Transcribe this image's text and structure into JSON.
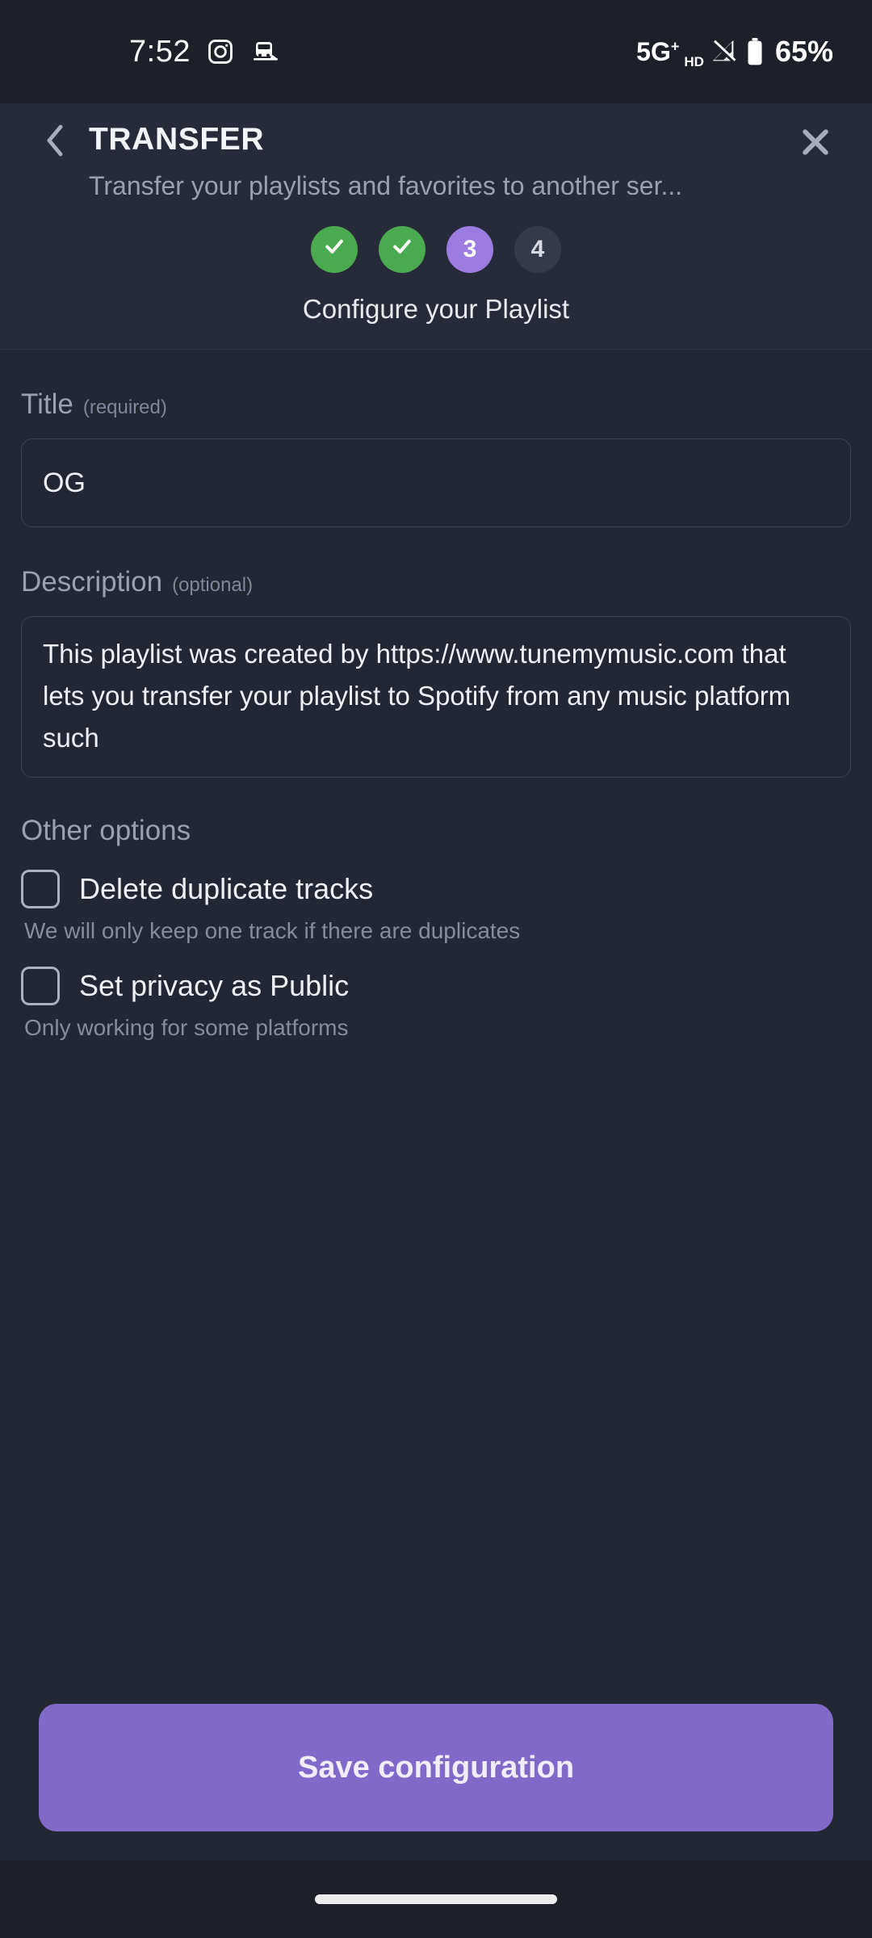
{
  "status_bar": {
    "time": "7:52",
    "icons": [
      "instagram-icon",
      "train-icon"
    ],
    "network": "5G",
    "network_plus": "+",
    "network_hd": "HD",
    "battery_percent": "65%"
  },
  "header": {
    "back_icon": "chevron-left-icon",
    "title": "TRANSFER",
    "subtitle": "Transfer your playlists and favorites to another ser...",
    "close_icon": "close-icon",
    "steps": [
      {
        "label": "✓",
        "state": "done"
      },
      {
        "label": "✓",
        "state": "done"
      },
      {
        "label": "3",
        "state": "current"
      },
      {
        "label": "4",
        "state": "pending"
      }
    ],
    "step_caption": "Configure your Playlist"
  },
  "form": {
    "title_field": {
      "label": "Title",
      "hint": "(required)",
      "value": "OG",
      "placeholder": "Title"
    },
    "description_field": {
      "label": "Description",
      "hint": "(optional)",
      "value": "This playlist was created by https://www.tunemymusic.com that lets you transfer your playlist to Spotify from any music platform such",
      "placeholder": "Description"
    }
  },
  "other_options": {
    "section_label": "Other options",
    "items": [
      {
        "title": "Delete duplicate tracks",
        "description": "We will only keep one track if there are duplicates",
        "checked": false
      },
      {
        "title": "Set privacy as Public",
        "description": "Only working for some platforms",
        "checked": false
      }
    ]
  },
  "footer": {
    "save_label": "Save configuration"
  },
  "colors": {
    "background": "#232734",
    "header_background": "#272b39",
    "status_bar": "#1e2029",
    "accent_purple": "#8069c9",
    "step_current": "#9b7ce0",
    "step_done_green": "#4aaa4f",
    "step_pending": "#353a4a",
    "input_border": "#3c4154",
    "text_primary": "#eef0f5",
    "text_muted": "#9aa0ae"
  }
}
